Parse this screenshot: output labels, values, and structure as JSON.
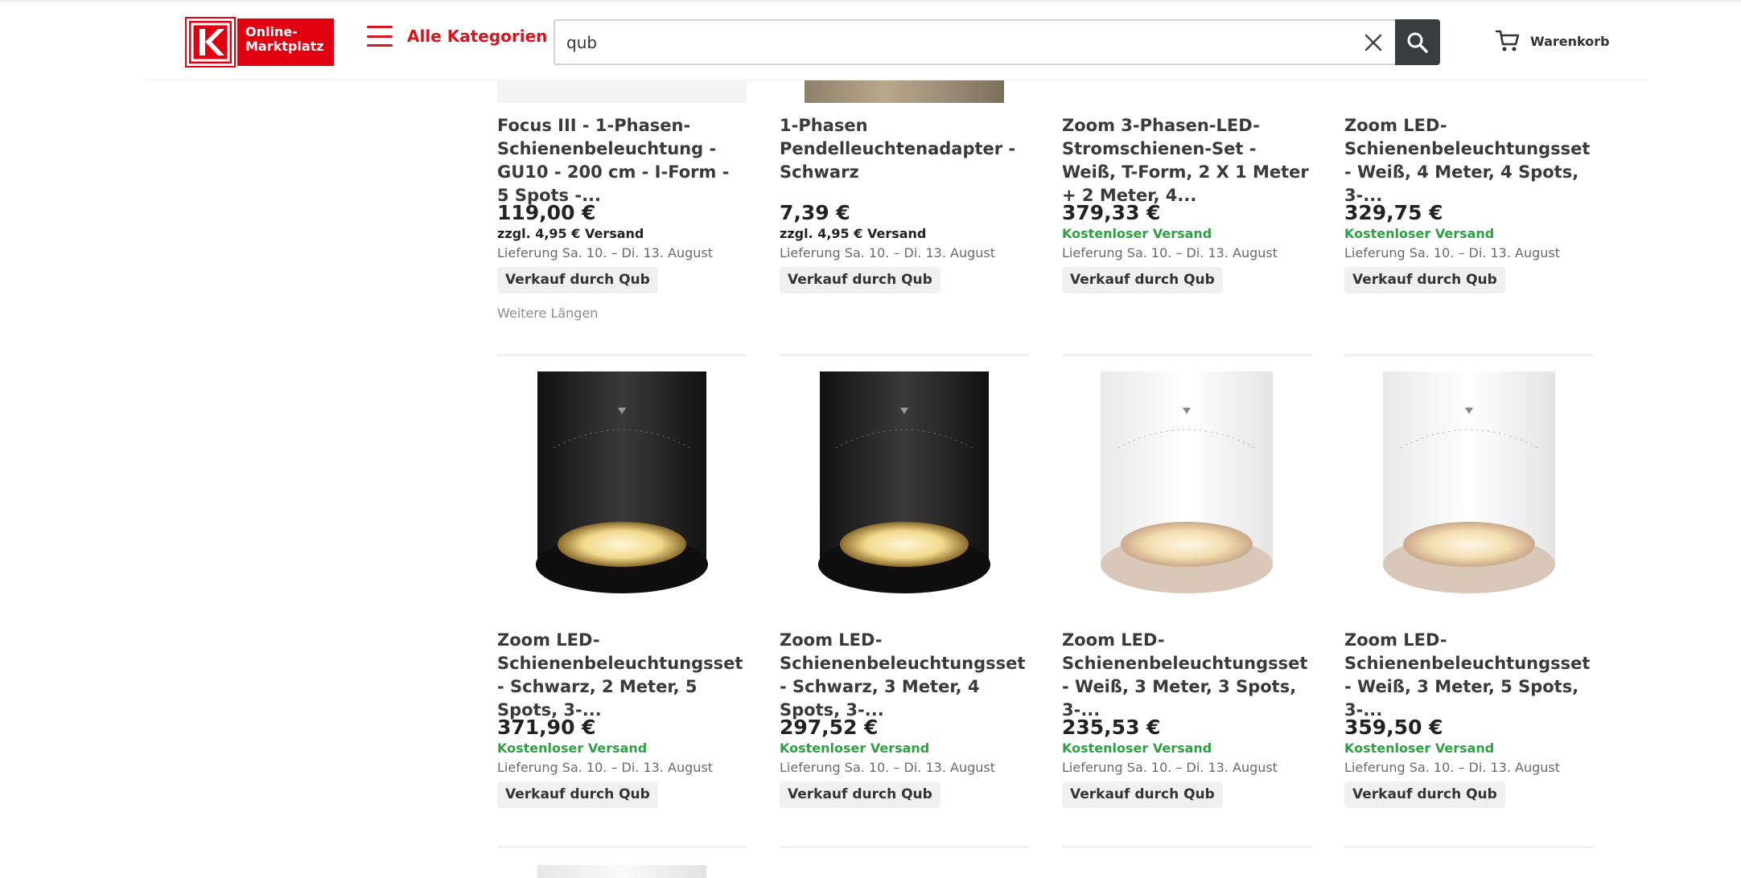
{
  "header": {
    "logo_text": "Online-\nMarktplatz",
    "logo_line1": "Online-",
    "logo_line2": "Marktplatz",
    "menu_label": "Alle Kategorien",
    "search_value": "qub",
    "cart_label": "Warenkorb",
    "icons": [
      "hamburger-menu-icon",
      "close-icon",
      "search-icon",
      "cart-icon"
    ],
    "brand_color": "#e1000f",
    "accent_color": "#d3161f"
  },
  "products_row1": [
    {
      "title": "Focus III - 1-Phasen-Schienenbeleuchtung - GU10 - 200 cm - I-Form - 5 Spots -...",
      "price": "119,00 €",
      "shipping": "zzgl. 4,95 € Versand",
      "shipping_free": false,
      "delivery": "Lieferung Sa. 10. – Di. 13. August",
      "seller": "Verkauf durch Qub",
      "extra": "Weitere Längen"
    },
    {
      "title": "1-Phasen Pendelleuchtenadapter - Schwarz",
      "price": "7,39 €",
      "shipping": "zzgl. 4,95 € Versand",
      "shipping_free": false,
      "delivery": "Lieferung Sa. 10. – Di. 13. August",
      "seller": "Verkauf durch Qub"
    },
    {
      "title": "Zoom 3-Phasen-LED-Stromschienen-Set - Weiß, T-Form, 2 X 1 Meter + 2 Meter, 4...",
      "price": "379,33 €",
      "shipping": "Kostenloser Versand",
      "shipping_free": true,
      "delivery": "Lieferung Sa. 10. – Di. 13. August",
      "seller": "Verkauf durch Qub"
    },
    {
      "title": "Zoom LED-Schienenbeleuchtungsset - Weiß, 4 Meter, 4 Spots, 3-...",
      "price": "329,75 €",
      "shipping": "Kostenloser Versand",
      "shipping_free": true,
      "delivery": "Lieferung Sa. 10. – Di. 13. August",
      "seller": "Verkauf durch Qub"
    }
  ],
  "products_row2": [
    {
      "title": "Zoom LED-Schienenbeleuchtungsset - Schwarz, 2 Meter, 5 Spots, 3-...",
      "price": "371,90 €",
      "shipping": "Kostenloser Versand",
      "delivery": "Lieferung Sa. 10. – Di. 13. August",
      "seller": "Verkauf durch Qub",
      "image_color": "black"
    },
    {
      "title": "Zoom LED-Schienenbeleuchtungsset - Schwarz, 3 Meter, 4 Spots, 3-...",
      "price": "297,52 €",
      "shipping": "Kostenloser Versand",
      "delivery": "Lieferung Sa. 10. – Di. 13. August",
      "seller": "Verkauf durch Qub",
      "image_color": "black"
    },
    {
      "title": "Zoom LED-Schienenbeleuchtungsset - Weiß, 3 Meter, 3 Spots, 3-...",
      "price": "235,53 €",
      "shipping": "Kostenloser Versand",
      "delivery": "Lieferung Sa. 10. – Di. 13. August",
      "seller": "Verkauf durch Qub",
      "image_color": "white"
    },
    {
      "title": "Zoom LED-Schienenbeleuchtungsset - Weiß, 3 Meter, 5 Spots, 3-...",
      "price": "359,50 €",
      "shipping": "Kostenloser Versand",
      "delivery": "Lieferung Sa. 10. – Di. 13. August",
      "seller": "Verkauf durch Qub",
      "image_color": "white"
    }
  ]
}
